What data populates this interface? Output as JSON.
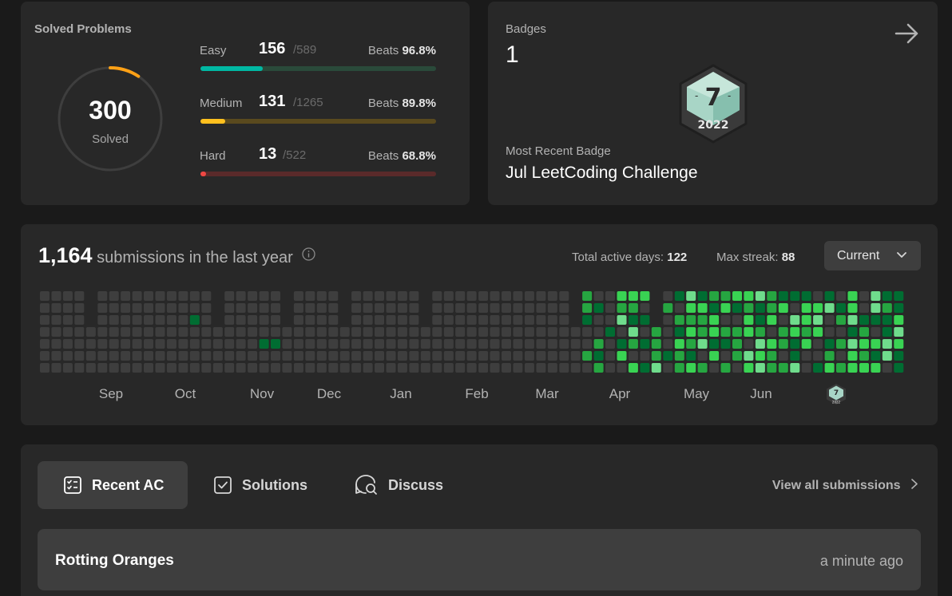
{
  "solved": {
    "title": "Solved Problems",
    "total": "300",
    "total_label": "Solved",
    "progress_fraction": 0.093,
    "difficulties": [
      {
        "name": "Easy",
        "solved": "156",
        "total": "/589",
        "beats_label": "Beats",
        "beats": "96.8%",
        "fraction": 0.265,
        "color": "#00b8a3",
        "track": "#2a4a3a"
      },
      {
        "name": "Medium",
        "solved": "131",
        "total": "/1265",
        "beats_label": "Beats",
        "beats": "89.8%",
        "fraction": 0.104,
        "color": "#ffc01e",
        "track": "#5a4a1e"
      },
      {
        "name": "Hard",
        "solved": "13",
        "total": "/522",
        "beats_label": "Beats",
        "beats": "68.8%",
        "fraction": 0.025,
        "color": "#ef4743",
        "track": "#5a2a2a"
      }
    ]
  },
  "badges": {
    "label": "Badges",
    "count": "1",
    "badge_icon": "jul-2022-badge-icon",
    "badge_month": "7",
    "badge_year": "2022",
    "recent_label": "Most Recent Badge",
    "recent_name": "Jul LeetCoding Challenge"
  },
  "calendar": {
    "submissions": "1,164",
    "submissions_text": "submissions in the last year",
    "active_days_label": "Total active days:",
    "active_days": "122",
    "max_streak_label": "Max streak:",
    "max_streak": "88",
    "year_select": "Current",
    "months": [
      "Sep",
      "Oct",
      "Nov",
      "Dec",
      "Jan",
      "Feb",
      "Mar",
      "Apr",
      "May",
      "Jun"
    ],
    "colors": {
      "empty": "#3e3e3e",
      "level1": "#006d32",
      "level2": "#26a641",
      "level3": "#39d353",
      "level4": "#6fdc8c"
    }
  },
  "recent": {
    "tabs": [
      {
        "label": "Recent AC",
        "icon": "checklist-icon",
        "active": true
      },
      {
        "label": "Solutions",
        "icon": "check-square-icon",
        "active": false
      },
      {
        "label": "Discuss",
        "icon": "discuss-search-icon",
        "active": false
      }
    ],
    "view_all": "View all submissions",
    "items": [
      {
        "title": "Rotting Oranges",
        "time": "a minute ago"
      }
    ]
  }
}
